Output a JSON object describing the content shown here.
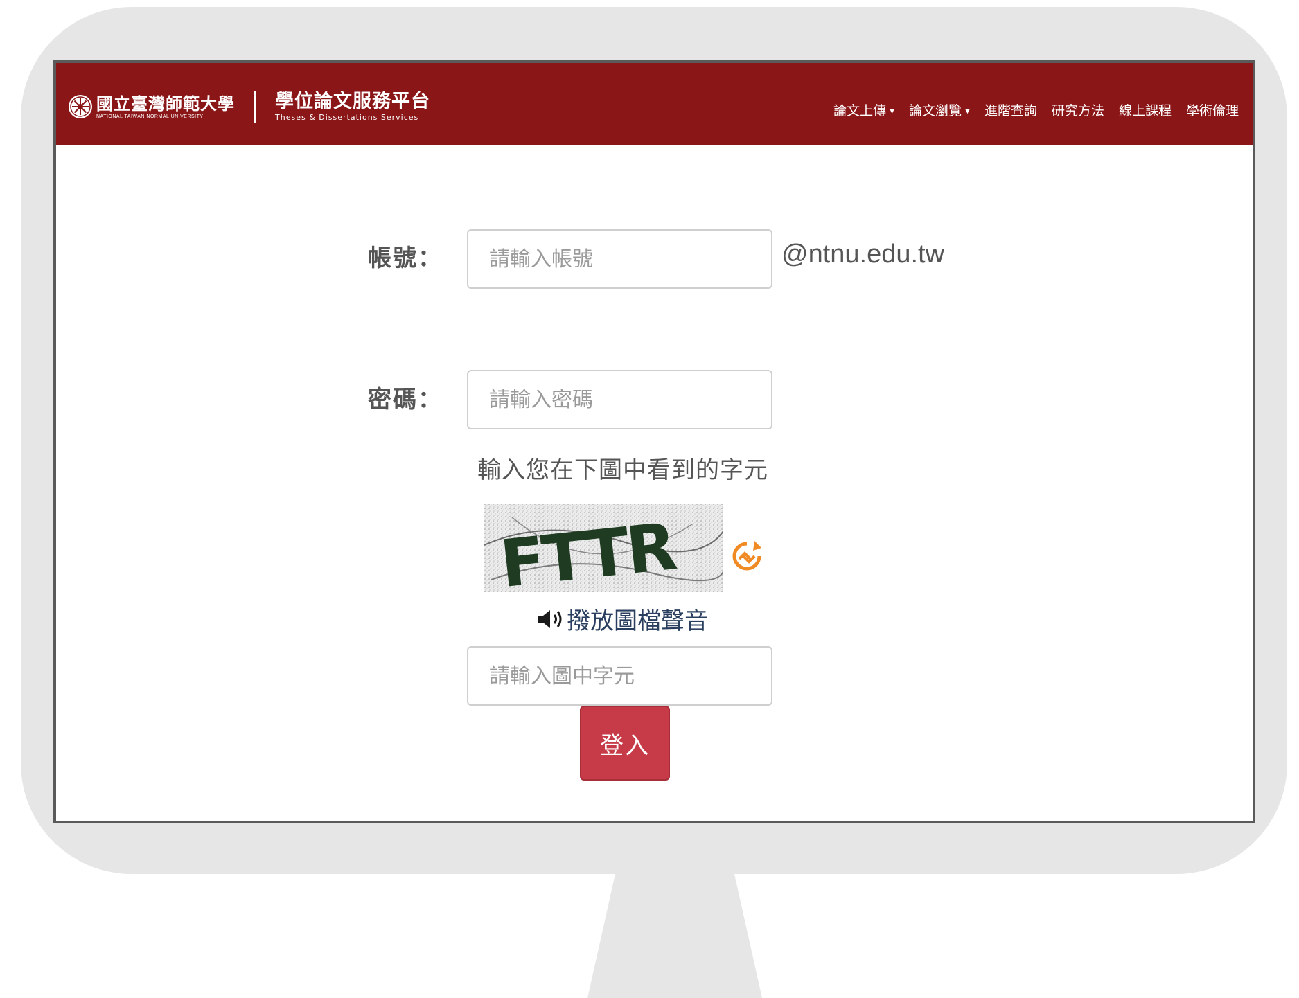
{
  "navbar": {
    "university_name": "國立臺灣師範大學",
    "university_name_en": "NATIONAL TAIWAN NORMAL UNIVERSITY",
    "platform_title": "學位論文服務平台",
    "platform_subtitle": "Theses & Dissertations Services",
    "menu": [
      {
        "label": "論文上傳",
        "dropdown": true
      },
      {
        "label": "論文瀏覽",
        "dropdown": true
      },
      {
        "label": "進階查詢",
        "dropdown": false
      },
      {
        "label": "研究方法",
        "dropdown": false
      },
      {
        "label": "線上課程",
        "dropdown": false
      },
      {
        "label": "學術倫理",
        "dropdown": false
      }
    ]
  },
  "form": {
    "account_label": "帳號：",
    "account_placeholder": "請輸入帳號",
    "account_value": "",
    "domain_suffix": "@ntnu.edu.tw",
    "password_label": "密碼：",
    "password_placeholder": "請輸入密碼",
    "password_value": "",
    "captcha_prompt": "輸入您在下圖中看到的字元",
    "captcha_text": "FTTR",
    "audio_label": "撥放圖檔聲音",
    "captcha_placeholder": "請輸入圖中字元",
    "captcha_value": "",
    "login_label": "登入"
  },
  "icons": {
    "seal": "university-seal-icon",
    "refresh": "refresh-icon",
    "audio": "speaker-icon",
    "dropdown": "caret-down-icon"
  },
  "colors": {
    "navbar_bg": "#8b1618",
    "login_button": "#c63b47",
    "refresh_icon": "#f08a24",
    "audio_link": "#2a3f5f"
  }
}
